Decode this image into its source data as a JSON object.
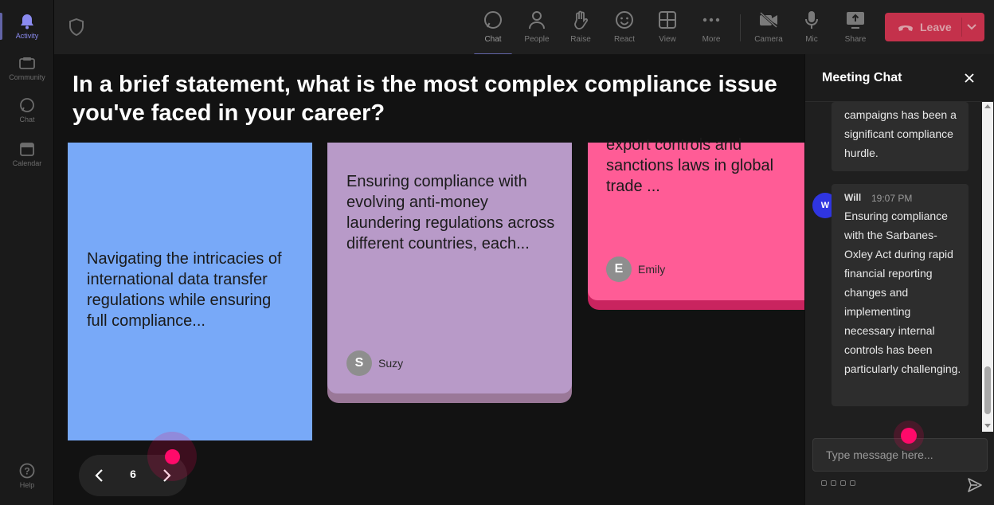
{
  "rail": {
    "items": [
      {
        "label": "Activity",
        "icon": "bell-icon"
      },
      {
        "label": "Community",
        "icon": "community-icon"
      },
      {
        "label": "Chat",
        "icon": "chat-icon"
      },
      {
        "label": "Calendar",
        "icon": "calendar-icon"
      },
      {
        "label": "Help",
        "icon": "help-icon"
      }
    ]
  },
  "toolbar": {
    "buttons": [
      {
        "label": "Chat",
        "icon": "chat-icon"
      },
      {
        "label": "People",
        "icon": "people-icon"
      },
      {
        "label": "Raise",
        "icon": "hand-icon"
      },
      {
        "label": "React",
        "icon": "smile-icon"
      },
      {
        "label": "View",
        "icon": "grid-icon"
      },
      {
        "label": "More",
        "icon": "more-icon"
      },
      {
        "label": "Camera",
        "icon": "camera-off-icon"
      },
      {
        "label": "Mic",
        "icon": "mic-icon"
      },
      {
        "label": "Share",
        "icon": "share-icon"
      }
    ],
    "leave_label": "Leave"
  },
  "stage": {
    "question": "In a brief statement, what is the most complex compliance issue you've faced in your career?",
    "cards": [
      {
        "text": "Navigating the intricacies of international data transfer regulations while ensuring full compliance...",
        "author": "",
        "initial": ""
      },
      {
        "text": "Ensuring compliance with evolving anti-money laundering regulations across different countries, each...",
        "author": "Suzy",
        "initial": "S"
      },
      {
        "text": "export controls and sanctions laws in global trade ...",
        "author": "Emily",
        "initial": "E"
      }
    ],
    "page_number": "6"
  },
  "chat": {
    "title": "Meeting Chat",
    "messages": [
      {
        "author": "",
        "time": "",
        "text": "campaigns has been a significant compliance hurdle."
      },
      {
        "author": "Will",
        "initial": "W",
        "time": "19:07 PM",
        "text": "Ensuring compliance with the Sarbanes-Oxley Act during rapid financial reporting changes and implementing necessary internal controls has been particularly challenging."
      }
    ],
    "input_placeholder": "Type message here..."
  },
  "colors": {
    "leave": "#c4314b",
    "card_blue": "#78a9f8",
    "card_purple": "#b89ac8",
    "card_pink": "#ff5c96",
    "accent": "#6264a7",
    "cursor_dot": "#ff0a6a"
  }
}
